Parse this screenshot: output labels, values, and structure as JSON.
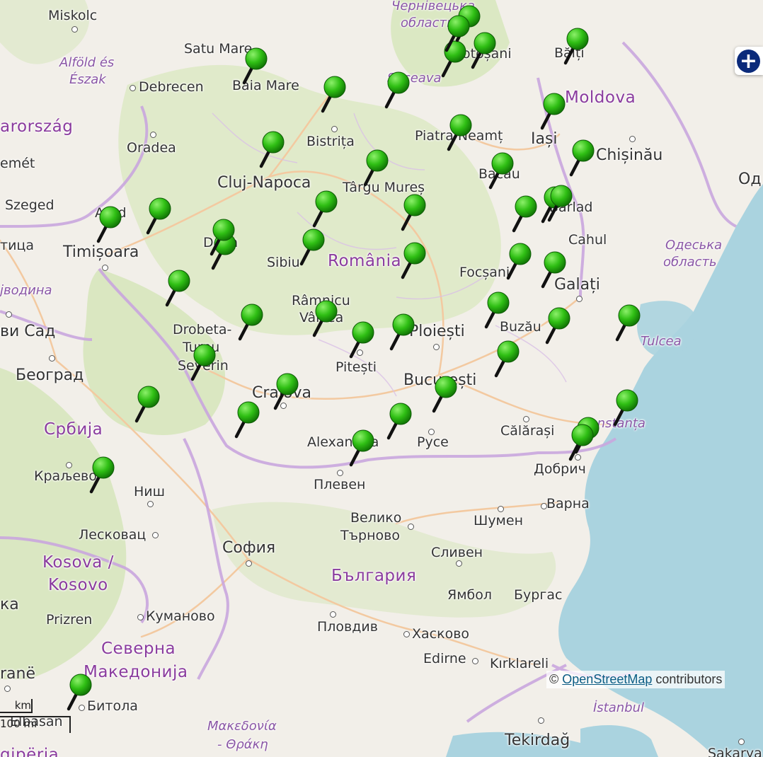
{
  "zoom": {
    "symbol": "+"
  },
  "attribution": {
    "prefix": "©",
    "link": "OpenStreetMap",
    "suffix": " contributors"
  },
  "scale": {
    "km": "km",
    "mi": "100 mi"
  },
  "labels": {
    "countries": [
      {
        "key": "moldova",
        "text": "Moldova"
      },
      {
        "key": "romania",
        "text": "România"
      },
      {
        "key": "srbija",
        "text": "Србија"
      },
      {
        "key": "kosovo1",
        "text": "Kosova /"
      },
      {
        "key": "kosovo2",
        "text": "Kosovo"
      },
      {
        "key": "bulgaria",
        "text": "България"
      },
      {
        "key": "mk1",
        "text": "Северна"
      },
      {
        "key": "mk2",
        "text": "Македонија"
      },
      {
        "key": "magyar",
        "text": "arország"
      }
    ],
    "regions": [
      {
        "key": "chernivtsi1",
        "text": "Чернівецька"
      },
      {
        "key": "chernivtsi2",
        "text": "область"
      },
      {
        "key": "alfold1",
        "text": "Alföld és"
      },
      {
        "key": "alfold2",
        "text": "Észak"
      },
      {
        "key": "suceava",
        "text": "Suceava"
      },
      {
        "key": "odesa1",
        "text": "Одеська"
      },
      {
        "key": "odesa2",
        "text": "область"
      },
      {
        "key": "vojvodina",
        "text": "јводина"
      },
      {
        "key": "tulcea",
        "text": "Tulcea"
      },
      {
        "key": "constanta",
        "text": "Constanța"
      },
      {
        "key": "makedonia",
        "text": "Μακεδονία"
      },
      {
        "key": "thraki",
        "text": "- Θράκη"
      },
      {
        "key": "istanbul",
        "text": "İstanbul"
      }
    ],
    "cities": [
      {
        "key": "miskolc",
        "text": "Miskolc"
      },
      {
        "key": "satumare",
        "text": "Satu Mare"
      },
      {
        "key": "baiamare",
        "text": "Baia Mare"
      },
      {
        "key": "debrecen",
        "text": "Debrecen"
      },
      {
        "key": "botosani",
        "text": "Botoșani"
      },
      {
        "key": "balti",
        "text": "Bălți"
      },
      {
        "key": "bistrita",
        "text": "Bistrița"
      },
      {
        "key": "piatra",
        "text": "Piatra Neamț"
      },
      {
        "key": "iasi",
        "text": "Iași"
      },
      {
        "key": "oradea",
        "text": "Oradea"
      },
      {
        "key": "chisinau",
        "text": "Chișinău"
      },
      {
        "key": "cluj",
        "text": "Cluj-Napoca"
      },
      {
        "key": "targumures",
        "text": "Târgu Mureș"
      },
      {
        "key": "bacau",
        "text": "Bacău"
      },
      {
        "key": "emet",
        "text": "emét"
      },
      {
        "key": "szeged",
        "text": "Szeged"
      },
      {
        "key": "arad",
        "text": "Arad"
      },
      {
        "key": "barlad",
        "text": "Bârlad"
      },
      {
        "key": "od",
        "text": "Од"
      },
      {
        "key": "deva",
        "text": "Deva"
      },
      {
        "key": "cahul",
        "text": "Cahul"
      },
      {
        "key": "tica",
        "text": "тица"
      },
      {
        "key": "timisoara",
        "text": "Timișoara"
      },
      {
        "key": "sibiu",
        "text": "Sibiu"
      },
      {
        "key": "focsani",
        "text": "Focșani"
      },
      {
        "key": "galati",
        "text": "Galați"
      },
      {
        "key": "ramnicu1",
        "text": "Râmnicu"
      },
      {
        "key": "ramnicu2",
        "text": "Vâlcea"
      },
      {
        "key": "novisad",
        "text": "ви Сад"
      },
      {
        "key": "drobeta1",
        "text": "Drobeta-"
      },
      {
        "key": "drobeta2",
        "text": "Turnu"
      },
      {
        "key": "drobeta3",
        "text": "Severin"
      },
      {
        "key": "ploiesti",
        "text": "Ploiești"
      },
      {
        "key": "buzau",
        "text": "Buzău"
      },
      {
        "key": "beograd",
        "text": "Београд"
      },
      {
        "key": "pitesti",
        "text": "Pitești"
      },
      {
        "key": "bucuresti",
        "text": "București"
      },
      {
        "key": "craiova",
        "text": "Craiova"
      },
      {
        "key": "calarasi",
        "text": "Călărași"
      },
      {
        "key": "alexandria",
        "text": "Alexandria"
      },
      {
        "key": "ruse",
        "text": "Русе"
      },
      {
        "key": "kraljevo",
        "text": "Краљево"
      },
      {
        "key": "dobrich",
        "text": "Добрич"
      },
      {
        "key": "pleven",
        "text": "Плевен"
      },
      {
        "key": "nish",
        "text": "Ниш"
      },
      {
        "key": "varna",
        "text": "Варна"
      },
      {
        "key": "veliko1",
        "text": "Велико"
      },
      {
        "key": "veliko2",
        "text": "Търново"
      },
      {
        "key": "shumen",
        "text": "Шумен"
      },
      {
        "key": "leskovac",
        "text": "Лесковац"
      },
      {
        "key": "sofia",
        "text": "София"
      },
      {
        "key": "sliven",
        "text": "Сливен"
      },
      {
        "key": "yambol",
        "text": "Ямбол"
      },
      {
        "key": "burgas",
        "text": "Бургас"
      },
      {
        "key": "ka",
        "text": "ка"
      },
      {
        "key": "prizren",
        "text": "Prizren"
      },
      {
        "key": "kumanovo",
        "text": "Куманово"
      },
      {
        "key": "plovdiv",
        "text": "Пловдив"
      },
      {
        "key": "haskovo",
        "text": "Хасково"
      },
      {
        "key": "edirne",
        "text": "Edirne"
      },
      {
        "key": "kirklareli",
        "text": "Kırklareli"
      },
      {
        "key": "rane",
        "text": "ranë"
      },
      {
        "key": "bitola",
        "text": "Битола"
      },
      {
        "key": "elbasan",
        "text": "Elbasan"
      },
      {
        "key": "tekirdag",
        "text": "Tekirdağ"
      },
      {
        "key": "sakarya",
        "text": "Sakarya"
      },
      {
        "key": "shqiperia",
        "text": "qipëria"
      }
    ]
  },
  "markers_count": 48,
  "colors": {
    "land": "#f2efe9",
    "sea": "#aad3df",
    "forest": "#d6e6b9",
    "border": "#b88fd0",
    "marker": "#2fbf14"
  }
}
